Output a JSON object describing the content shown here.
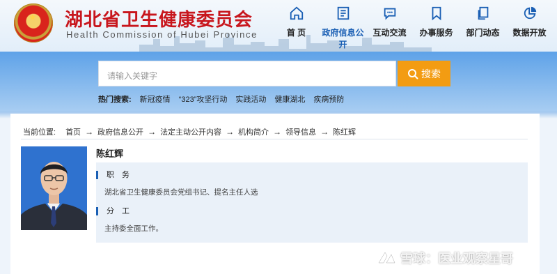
{
  "brand": {
    "name_cn": "湖北省卫生健康委员会",
    "name_en": "Health Commission of Hubei Province"
  },
  "nav": [
    {
      "label": "首 页",
      "icon": "home-icon"
    },
    {
      "label": "政府信息公开",
      "icon": "document-icon",
      "active": true
    },
    {
      "label": "互动交流",
      "icon": "chat-icon"
    },
    {
      "label": "办事服务",
      "icon": "bookmark-icon"
    },
    {
      "label": "部门动态",
      "icon": "copy-icon"
    },
    {
      "label": "数据开放",
      "icon": "pie-chart-icon"
    }
  ],
  "search": {
    "placeholder": "请输入关键字",
    "button_label": "搜索",
    "hot_label": "热门搜索:",
    "hot_terms": [
      "新冠疫情",
      "“323”攻坚行动",
      "实践活动",
      "健康湖北",
      "疾病预防"
    ]
  },
  "breadcrumb": {
    "label": "当前位置:",
    "items": [
      "首页",
      "政府信息公开",
      "法定主动公开内容",
      "机构简介",
      "领导信息",
      "陈红辉"
    ]
  },
  "profile": {
    "name": "陈红辉",
    "sections": [
      {
        "title": "职　务",
        "body": "湖北省卫生健康委员会党组书记、提名主任人选"
      },
      {
        "title": "分　工",
        "body": "主持委全面工作。"
      }
    ]
  },
  "watermark": "雪球：医业观察星哥",
  "colors": {
    "brand_red": "#c8161d",
    "nav_active": "#1a5fb4",
    "search_button": "#f39c12"
  }
}
